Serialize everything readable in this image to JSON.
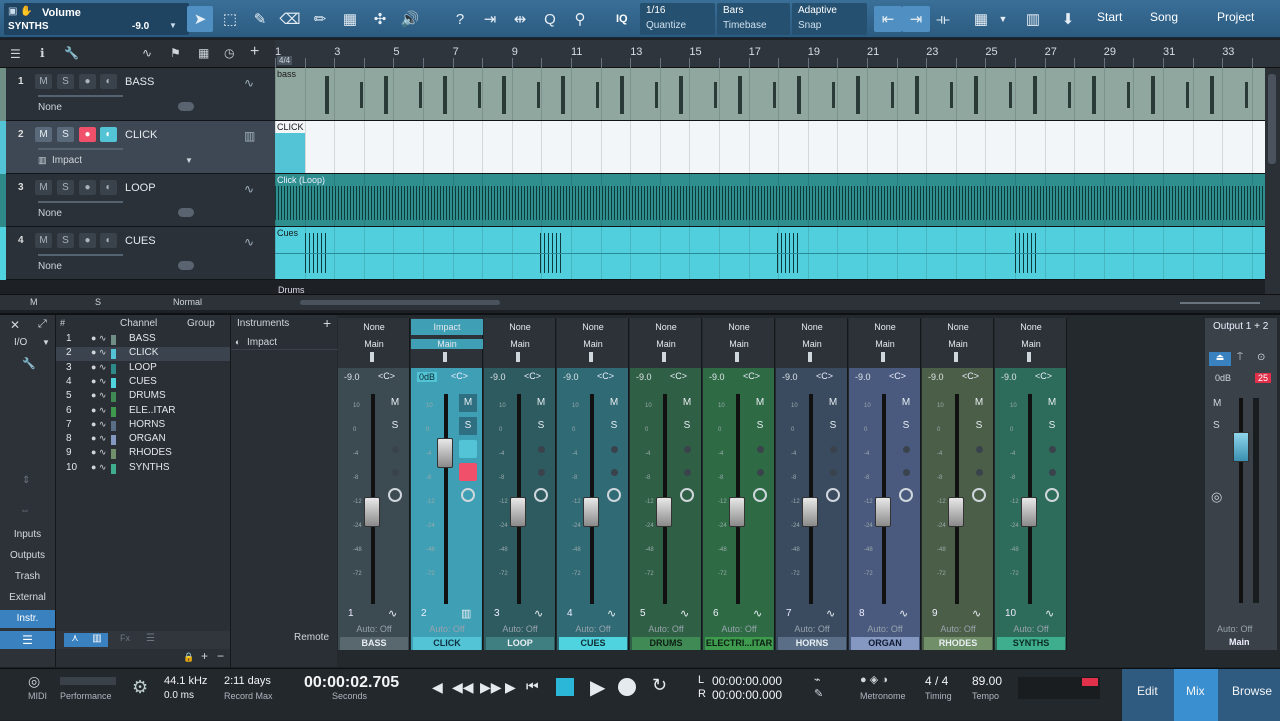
{
  "toolbar": {
    "param_name": "Volume",
    "track_name": "SYNTHS",
    "param_value": "-9.0",
    "iq_label": "IQ",
    "quantize_value": "1/16",
    "quantize_label": "Quantize",
    "timebase_value": "Bars",
    "timebase_label": "Timebase",
    "snap_value": "Adaptive",
    "snap_label": "Snap",
    "nav": [
      "Start",
      "Song",
      "Project"
    ]
  },
  "ruler": {
    "marks": [
      "1",
      "3",
      "5",
      "7",
      "9",
      "11",
      "13",
      "15",
      "17",
      "19",
      "21",
      "23",
      "25",
      "27",
      "29",
      "31",
      "33"
    ],
    "signature": "4/4"
  },
  "tracks": [
    {
      "num": "1",
      "name": "BASS",
      "sub": "None",
      "color": "#6f8f86",
      "lane_color": "#8fa79f",
      "lane_label": "bass",
      "selected": false
    },
    {
      "num": "2",
      "name": "CLICK",
      "sub": "Impact",
      "color": "#52c4d6",
      "lane_color": "#f2f6f8",
      "lane_label": "CLICK",
      "selected": true
    },
    {
      "num": "3",
      "name": "LOOP",
      "sub": "None",
      "color": "#2e8a89",
      "lane_color": "#2f8f8e",
      "lane_label": "Click (Loop)",
      "selected": false
    },
    {
      "num": "4",
      "name": "CUES",
      "sub": "None",
      "color": "#4fd3de",
      "lane_color": "#52cfdc",
      "lane_label": "Cues",
      "selected": false
    }
  ],
  "track_footer": {
    "m": "M",
    "s": "S",
    "mode": "Normal",
    "next_track": "DRUMS",
    "next_lane": "Drums"
  },
  "left_panel": {
    "io": "I/O",
    "items": [
      "Inputs",
      "Outputs",
      "Trash",
      "External",
      "Instr."
    ],
    "active": "Instr."
  },
  "channel_list": {
    "header_channel": "Channel",
    "header_group": "Group",
    "rows": [
      {
        "n": "1",
        "name": "BASS",
        "color": "#6f8f86"
      },
      {
        "n": "2",
        "name": "CLICK",
        "color": "#52c4d6"
      },
      {
        "n": "3",
        "name": "LOOP",
        "color": "#2e8a89"
      },
      {
        "n": "4",
        "name": "CUES",
        "color": "#4fd3de"
      },
      {
        "n": "5",
        "name": "DRUMS",
        "color": "#3f8a55"
      },
      {
        "n": "6",
        "name": "ELE..ITAR",
        "color": "#3e9a4d"
      },
      {
        "n": "7",
        "name": "HORNS",
        "color": "#5a6f87"
      },
      {
        "n": "8",
        "name": "ORGAN",
        "color": "#8598c2"
      },
      {
        "n": "9",
        "name": "RHODES",
        "color": "#71906a"
      },
      {
        "n": "10",
        "name": "SYNTHS",
        "color": "#3fae8e"
      }
    ]
  },
  "instruments": {
    "header": "Instruments",
    "items": [
      "Impact"
    ],
    "remote": "Remote"
  },
  "strips": [
    {
      "num": "1",
      "name": "BASS",
      "top1": "None",
      "top2": "Main",
      "vol": "-9.0",
      "pan": "<C>",
      "bg": "#3c4a52",
      "labelbg": "#59676f",
      "labelfg": "#e8eef2",
      "fader": 0.44
    },
    {
      "num": "2",
      "name": "CLICK",
      "top1": "Impact",
      "top2": "Main",
      "vol": "0dB",
      "pan": "<C>",
      "bg": "#3f9fb5",
      "labelbg": "#52c4d6",
      "labelfg": "#103040",
      "fader": 0.72
    },
    {
      "num": "3",
      "name": "LOOP",
      "top1": "None",
      "top2": "Main",
      "vol": "-9.0",
      "pan": "<C>",
      "bg": "#2d5b60",
      "labelbg": "#3f7f82",
      "labelfg": "#e8eef2",
      "fader": 0.44
    },
    {
      "num": "4",
      "name": "CUES",
      "top1": "None",
      "top2": "Main",
      "vol": "-9.0",
      "pan": "<C>",
      "bg": "#2f6a75",
      "labelbg": "#4fd3de",
      "labelfg": "#0d2b31",
      "fader": 0.44
    },
    {
      "num": "5",
      "name": "DRUMS",
      "top1": "None",
      "top2": "Main",
      "vol": "-9.0",
      "pan": "<C>",
      "bg": "#2f5f45",
      "labelbg": "#3f8a55",
      "labelfg": "#0d1f14",
      "fader": 0.44
    },
    {
      "num": "6",
      "name": "ELECTRI...ITAR",
      "top1": "None",
      "top2": "Main",
      "vol": "-9.0",
      "pan": "<C>",
      "bg": "#2e6b45",
      "labelbg": "#3e9a4d",
      "labelfg": "#0d1f14",
      "fader": 0.44
    },
    {
      "num": "7",
      "name": "HORNS",
      "top1": "None",
      "top2": "Main",
      "vol": "-9.0",
      "pan": "<C>",
      "bg": "#3a4b60",
      "labelbg": "#5a6f87",
      "labelfg": "#e8eef2",
      "fader": 0.44
    },
    {
      "num": "8",
      "name": "ORGAN",
      "top1": "None",
      "top2": "Main",
      "vol": "-9.0",
      "pan": "<C>",
      "bg": "#4a5a7e",
      "labelbg": "#8598c2",
      "labelfg": "#101a30",
      "fader": 0.44
    },
    {
      "num": "9",
      "name": "RHODES",
      "top1": "None",
      "top2": "Main",
      "vol": "-9.0",
      "pan": "<C>",
      "bg": "#4b5f48",
      "labelbg": "#71906a",
      "labelfg": "#e8eef2",
      "fader": 0.44
    },
    {
      "num": "10",
      "name": "SYNTHS",
      "top1": "None",
      "top2": "Main",
      "vol": "-9.0",
      "pan": "<C>",
      "bg": "#2d6b5a",
      "labelbg": "#3fae8e",
      "labelfg": "#0b2a22",
      "fader": 0.44
    }
  ],
  "strip_common": {
    "auto": "Auto: Off",
    "m": "M",
    "s": "S"
  },
  "output": {
    "title": "Output 1 + 2",
    "vol": "0dB",
    "peak": "25",
    "auto": "Auto: Off",
    "name": "Main",
    "m": "M",
    "s": "S"
  },
  "transport": {
    "midi": "MIDI",
    "performance": "Performance",
    "sample_rate": "44.1 kHz",
    "latency": "0.0 ms",
    "record_days": "2:11 days",
    "record_label": "Record Max",
    "time": "00:00:02.705",
    "time_label": "Seconds",
    "l_label": "L",
    "r_label": "R",
    "l_time": "00:00:00.000",
    "r_time": "00:00:00.000",
    "metronome": "Metronome",
    "timing_value": "4 / 4",
    "timing_label": "Timing",
    "tempo_value": "89.00",
    "tempo_label": "Tempo",
    "views": [
      "Edit",
      "Mix",
      "Browse"
    ],
    "active_view": "Mix"
  }
}
